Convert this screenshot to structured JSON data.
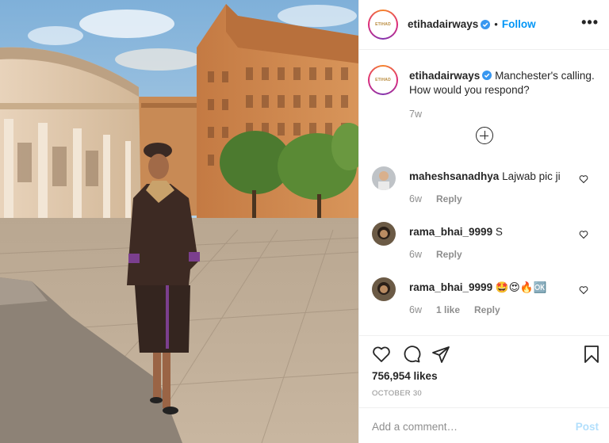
{
  "post": {
    "author": "etihadairways",
    "follow_label": "Follow",
    "separator": "•",
    "more_label": "•••",
    "caption": "Manchester's calling. How would you respond?",
    "caption_time": "7w",
    "likes": "756,954 likes",
    "date": "OCTOBER 30",
    "add_comment_placeholder": "Add a comment…",
    "post_label": "Post"
  },
  "comments": [
    {
      "user": "maheshsanadhya",
      "text": "Lajwab pic ji",
      "time": "6w",
      "likes": "",
      "reply": "Reply"
    },
    {
      "user": "rama_bhai_9999",
      "text": "S",
      "time": "6w",
      "likes": "",
      "reply": "Reply"
    },
    {
      "user": "rama_bhai_9999",
      "text": "🤩😍🔥🆗",
      "time": "6w",
      "likes": "1 like",
      "reply": "Reply"
    }
  ],
  "icons": {
    "verified": "verified-badge-icon",
    "more": "more-options-icon",
    "load_more": "load-more-comments-icon",
    "heart": "heart-icon",
    "comment": "comment-icon",
    "share": "share-icon",
    "save": "bookmark-icon"
  },
  "colors": {
    "follow": "#0095f6",
    "verified": "#3897f0",
    "muted": "#8e8e8e",
    "post_disabled": "#b2dffc",
    "text": "#262626"
  }
}
